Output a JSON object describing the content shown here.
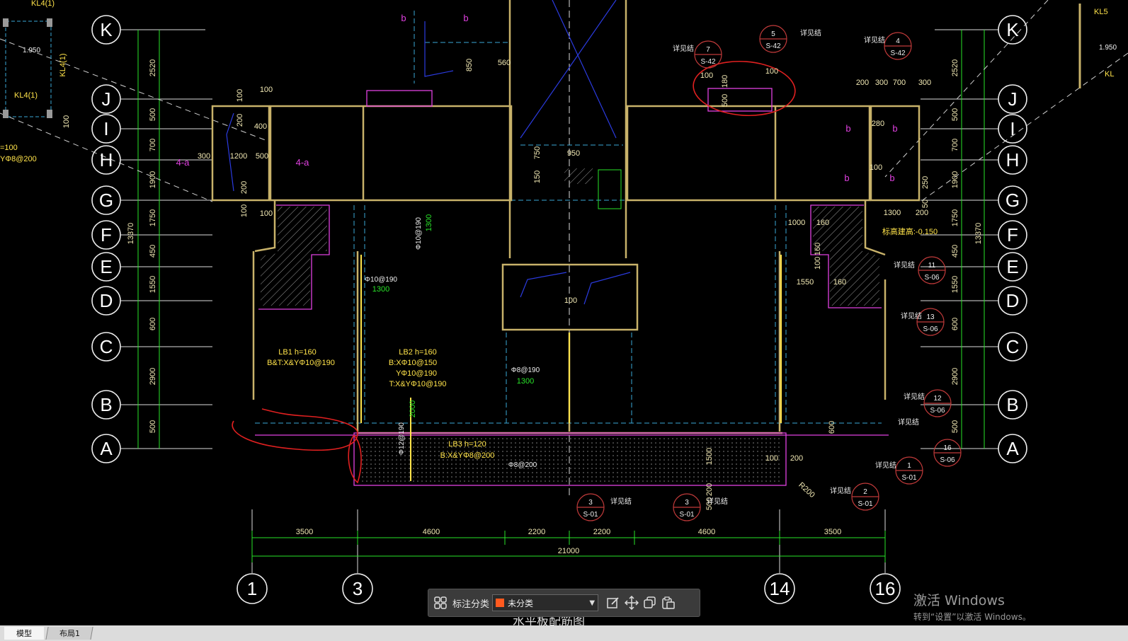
{
  "grid_rows": [
    "K",
    "J",
    "I",
    "H",
    "G",
    "F",
    "E",
    "D",
    "C",
    "B",
    "A"
  ],
  "grid_cols_bottom": [
    "1",
    "3",
    "14",
    "16"
  ],
  "left_dims": [
    "2520",
    "500",
    "700",
    "1900",
    "1750",
    "450",
    "1550",
    "600",
    "2900",
    "500"
  ],
  "right_dims": [
    "2520",
    "500",
    "700",
    "1900",
    "1750",
    "450",
    "1550",
    "600",
    "2900",
    "500"
  ],
  "overall_height": "13370",
  "bottom_dims": [
    "3500",
    "4600",
    "2200",
    "2200",
    "4600",
    "3500"
  ],
  "overall_width": "21000",
  "room_labels": [
    "4-a",
    "4-a"
  ],
  "b_labels": [
    "b",
    "b",
    "b",
    "b",
    "b",
    "b"
  ],
  "slabs": {
    "lb1": [
      "LB1 h=160",
      "B&T:X&YΦ10@190"
    ],
    "lb2": [
      "LB2 h=160",
      "B:XΦ10@150",
      "YΦ10@190",
      "T:X&YΦ10@190"
    ],
    "lb3": [
      "LB3 h=120",
      "B:X&YΦ8@200"
    ]
  },
  "rebar_notes": [
    "Φ10@190",
    "1300",
    "Φ10@190",
    "1300",
    "Φ8@190",
    "1300",
    "Φ12@190",
    "2000",
    "Φ8@200",
    "1300"
  ],
  "misc_dims": [
    "100",
    "100",
    "200",
    "400",
    "1200",
    "500",
    "300",
    "200",
    "100",
    "100",
    "950",
    "750",
    "150",
    "100",
    "100",
    "180",
    "500",
    "100",
    "850",
    "560",
    "200",
    "300",
    "700",
    "300",
    "280",
    "100",
    "1300",
    "200",
    "50",
    "250",
    "1000",
    "160",
    "100",
    "160",
    "1550",
    "160",
    "600",
    "1500",
    "200",
    "100",
    "200",
    "500",
    "100",
    "R200"
  ],
  "elev_note": "标高建高:-0.150",
  "callouts": [
    {
      "num": "5",
      "sheet": "S-42",
      "tag": "详见结"
    },
    {
      "num": "7",
      "sheet": "S-42",
      "tag": "详见结"
    },
    {
      "num": "4",
      "sheet": "S-42",
      "tag": "详见结"
    },
    {
      "num": "11",
      "sheet": "S-06",
      "tag": "详见结"
    },
    {
      "num": "13",
      "sheet": "S-06",
      "tag": "详见结"
    },
    {
      "num": "12",
      "sheet": "S-06",
      "tag": "详见结"
    },
    {
      "num": "16",
      "sheet": "S-06",
      "tag": "详见结"
    },
    {
      "num": "1",
      "sheet": "S-01",
      "tag": "详见结"
    },
    {
      "num": "2",
      "sheet": "S-01",
      "tag": "详见结"
    },
    {
      "num": "3",
      "sheet": "S-01",
      "tag": "详见结"
    },
    {
      "num": "3",
      "sheet": "S-01",
      "tag": "详见结"
    }
  ],
  "top_left_notes": [
    "KL4(1)",
    "1.950",
    "KL4(1)",
    "KL4(1)",
    "=100",
    "YΦ8@200",
    "100"
  ],
  "top_right_notes": [
    "KL5",
    "1.950",
    "KL"
  ],
  "bottom_title": "水平板配筋图",
  "toolbar": {
    "label": "标注分类",
    "select_value": "未分类",
    "swatch_color": "#ff5a1f"
  },
  "tabs": [
    "模型",
    "布局1"
  ],
  "watermark": {
    "title": "激活 Windows",
    "subtitle": "转到“设置”以激活 Windows。"
  },
  "colors": {
    "wall": "#c8b26a",
    "dim": "#29e429",
    "beam": "#3aa7d6",
    "pink": "#e040e0",
    "markup": "#e02020",
    "background": "#000000"
  }
}
